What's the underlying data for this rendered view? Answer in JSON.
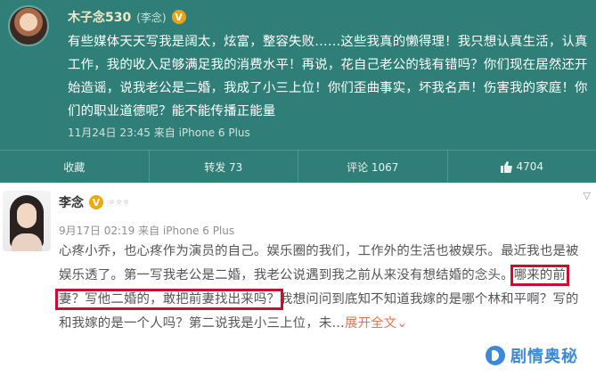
{
  "post1": {
    "user_name": "木子念530",
    "user_real_name": "(李念)",
    "content": "有些媒体天天写我是阔太，炫富，整容失败……这些我真的懒得理！我只想认真生活，认真工作，我的收入足够满足我的消费水平！再说，花自己老公的钱有错吗？你们现在居然还开始造谣，说我老公是二婚，我成了小三上位！你们歪曲事实，坏我名声！伤害我的家庭！你们的职业道德呢？能不能传播正能量",
    "meta": "11月24日 23:45 来自 iPhone 6 Plus",
    "actions": {
      "favorite": "收藏",
      "repost": "转发 73",
      "comment": "评论 1067",
      "like": "4704"
    }
  },
  "post2": {
    "user_name": "李念",
    "meta": "9月17日 02:19 来自 iPhone 6 Plus",
    "content_before": "心疼小乔，也心疼作为演员的自己。娱乐圈的我们，工作外的生活也被娱乐。最近我也是被娱乐透了。第一写我老公是二婚，我老公说遇到我之前从来没有想结婚的念头。",
    "content_highlight": "哪来的前妻？写他二婚的，敢把前妻找出来吗？",
    "content_after": "我想问问到底知不知道我嫁的是哪个林和平啊？写的和我嫁的是一个人吗？第二说我是小三上位，未…",
    "expand": "展开全文",
    "expand_arrow": "⌄"
  },
  "watermark": "剧情奥秘"
}
